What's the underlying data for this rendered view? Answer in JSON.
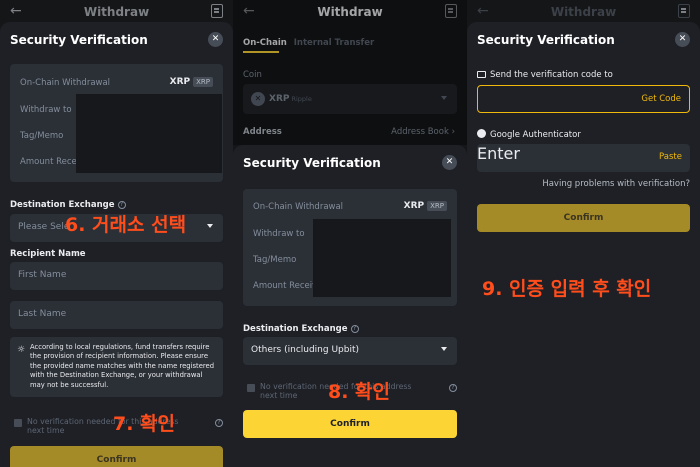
{
  "colors": {
    "accent": "#fcd535",
    "background": "#1e2026",
    "annotation": "#ff4d1c"
  },
  "topbar": {
    "title": "Withdraw"
  },
  "panel1": {
    "sheet_title": "Security Verification",
    "card": {
      "on_chain_label": "On-Chain Withdrawal",
      "coin": "XRP",
      "coin_tag": "XRP",
      "withdraw_to_label": "Withdraw to",
      "tag_memo_label": "Tag/Memo",
      "amount_label": "Amount Receive"
    },
    "destination_exchange_label": "Destination Exchange",
    "destination_placeholder": "Please Sele",
    "recipient_name_label": "Recipient Name",
    "first_name_placeholder": "First Name",
    "last_name_placeholder": "Last Name",
    "notice": "According to local regulations, fund transfers require the provision of recipient information. Please ensure the provided name matches with the name registered with the Destination Exchange, or your withdrawal may not be successful.",
    "checkbox_text": "No verification needed for this address next time",
    "confirm_label": "Confirm",
    "annotation_top": "6. 거래소 선택",
    "annotation_bottom": "7. 확인"
  },
  "panel2": {
    "tab_on_chain": "On-Chain",
    "tab_internal": "Internal Transfer",
    "coin_label": "Coin",
    "coin_name": "XRP",
    "coin_full": "Ripple",
    "address_label": "Address",
    "address_book": "Address Book",
    "sheet_title": "Security Verification",
    "card": {
      "on_chain_label": "On-Chain Withdrawal",
      "coin": "XRP",
      "coin_tag": "XRP",
      "withdraw_to_label": "Withdraw to",
      "tag_memo_label": "Tag/Memo",
      "amount_label": "Amount Receive"
    },
    "destination_exchange_label": "Destination Exchange",
    "destination_value": "Others (including Upbit)",
    "checkbox_text": "No verification needed for this address next time",
    "confirm_label": "Confirm",
    "annotation": "8. 확인"
  },
  "panel3": {
    "sheet_title": "Security Verification",
    "send_code_label": "Send the verification code to",
    "get_code": "Get Code",
    "google_auth_label": "Google Authenticator",
    "enter_placeholder": "Enter",
    "paste": "Paste",
    "problems": "Having problems with verification?",
    "confirm_label": "Confirm",
    "annotation": "9. 인증 입력 후 확인"
  }
}
